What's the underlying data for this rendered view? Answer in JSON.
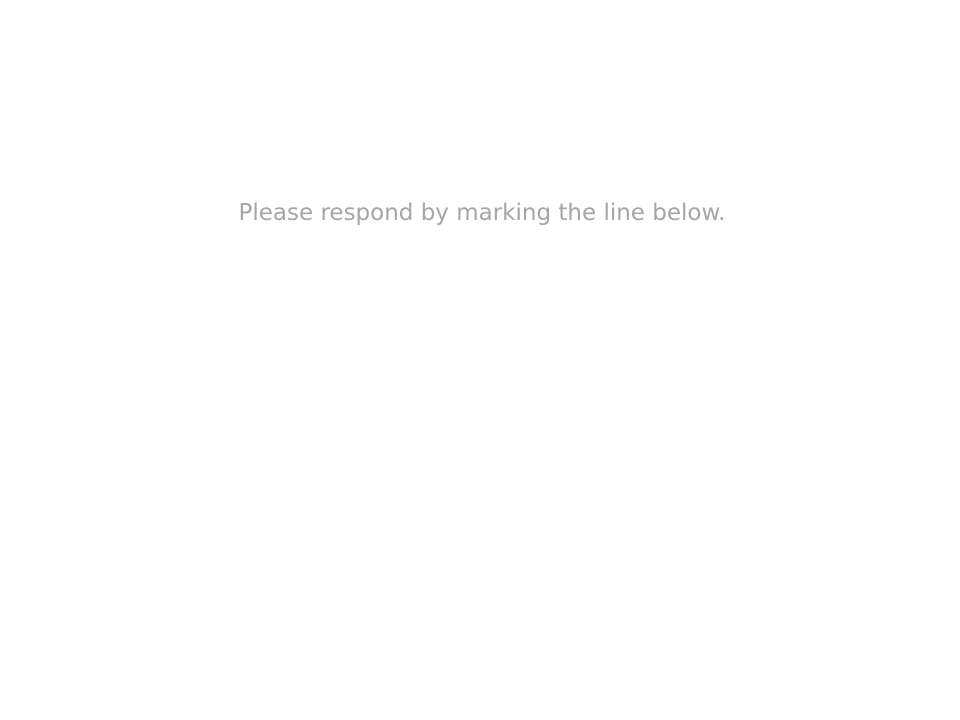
{
  "instruction": {
    "text": "Please respond by marking the line below.",
    "color": "#a6a6a6"
  },
  "background_color": "#ffffff"
}
